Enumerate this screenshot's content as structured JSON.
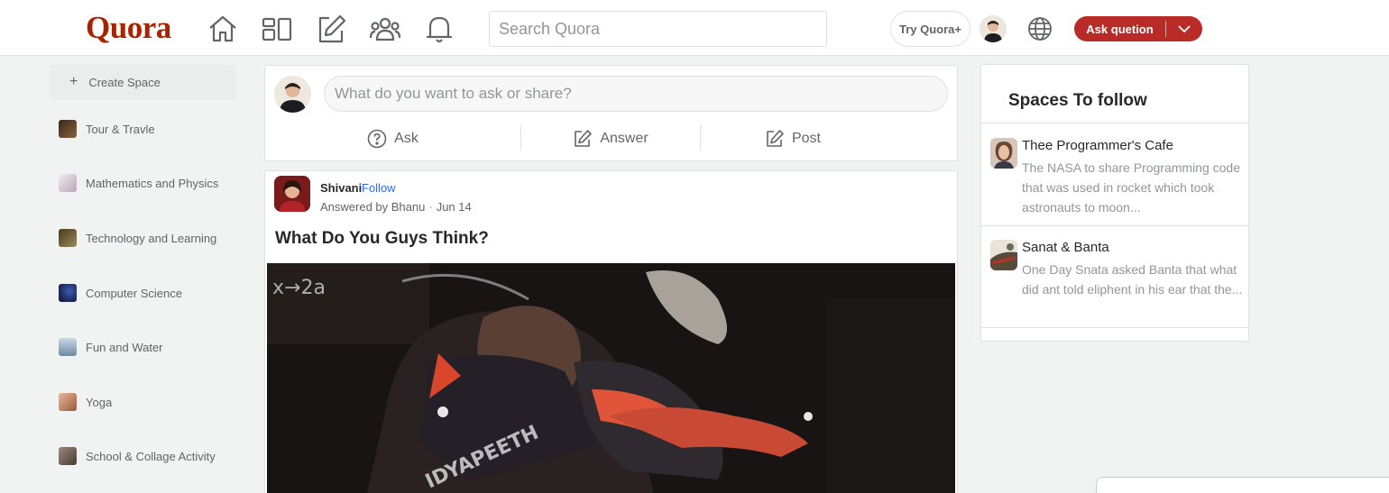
{
  "header": {
    "logo": "Quora",
    "search_placeholder": "Search Quora",
    "try_label": "Try Quora+",
    "ask_label": "Ask quetion",
    "brand_color": "#b92b27",
    "logo_color": "#a82400",
    "nav_icons": [
      "home-icon",
      "following-icon",
      "answer-icon",
      "spaces-icon",
      "notifications-icon"
    ]
  },
  "sidebar": {
    "create_label": "Create Space",
    "items": [
      {
        "label": "Tour & Travle",
        "thumb_color": "#5b3a24"
      },
      {
        "label": "Mathematics and Physics",
        "thumb_color": "#d9cfd8"
      },
      {
        "label": "Technology and Learning",
        "thumb_color": "#6b5a2e"
      },
      {
        "label": "Computer Science",
        "thumb_color": "#12204a"
      },
      {
        "label": "Fun and Water",
        "thumb_color": "#8fa3b5"
      },
      {
        "label": "Yoga",
        "thumb_color": "#c98a5f"
      },
      {
        "label": "School & Collage Activity",
        "thumb_color": "#7a6a60"
      }
    ]
  },
  "composer": {
    "placeholder": "What do you want to ask or share?",
    "ask_label": "Ask",
    "answer_label": "Answer",
    "post_label": "Post"
  },
  "post": {
    "author": "Shivani",
    "follow_label": "Follow",
    "answered_by": "Answered by Bhanu",
    "date": "Jun 14",
    "title": "What Do You Guys Think?"
  },
  "spaces_to_follow": {
    "title": "Spaces To follow",
    "items": [
      {
        "name": "Thee Programmer's Cafe",
        "desc": "The NASA to share Programming code that was used in rocket which took astronauts to moon...",
        "thumb_color": "#8a6a55"
      },
      {
        "name": "Sanat & Banta",
        "desc": "One Day Snata asked Banta that what did ant told eliphent in his ear that the...",
        "thumb_color": "#6e6a5a"
      }
    ]
  }
}
